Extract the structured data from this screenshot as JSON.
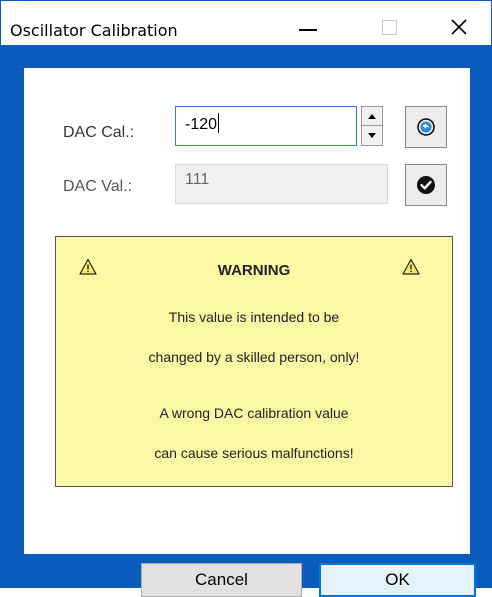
{
  "window": {
    "title": "Oscillator Calibration"
  },
  "titlebar": {
    "minimize_icon": "minimize-icon",
    "maximize_icon": "maximize-icon",
    "close_icon": "close-icon"
  },
  "form": {
    "dac_cal_label": "DAC Cal.:",
    "dac_cal_value": "-120",
    "dac_val_label": "DAC Val.:",
    "dac_val_value": "111",
    "reset_icon": "reset-icon",
    "apply_icon": "check-circle-icon"
  },
  "warning": {
    "title": "WARNING",
    "line1": "This value is intended to be",
    "line2": "changed by a skilled person, only!",
    "line3": "A wrong DAC calibration value",
    "line4": "can cause serious malfunctions!",
    "icon": "warning-triangle-icon"
  },
  "buttons": {
    "cancel_label": "Cancel",
    "ok_label": "OK"
  },
  "colors": {
    "frame": "#0a5cbd",
    "warning_bg": "#fbf7a4",
    "focus": "#0078d7"
  }
}
